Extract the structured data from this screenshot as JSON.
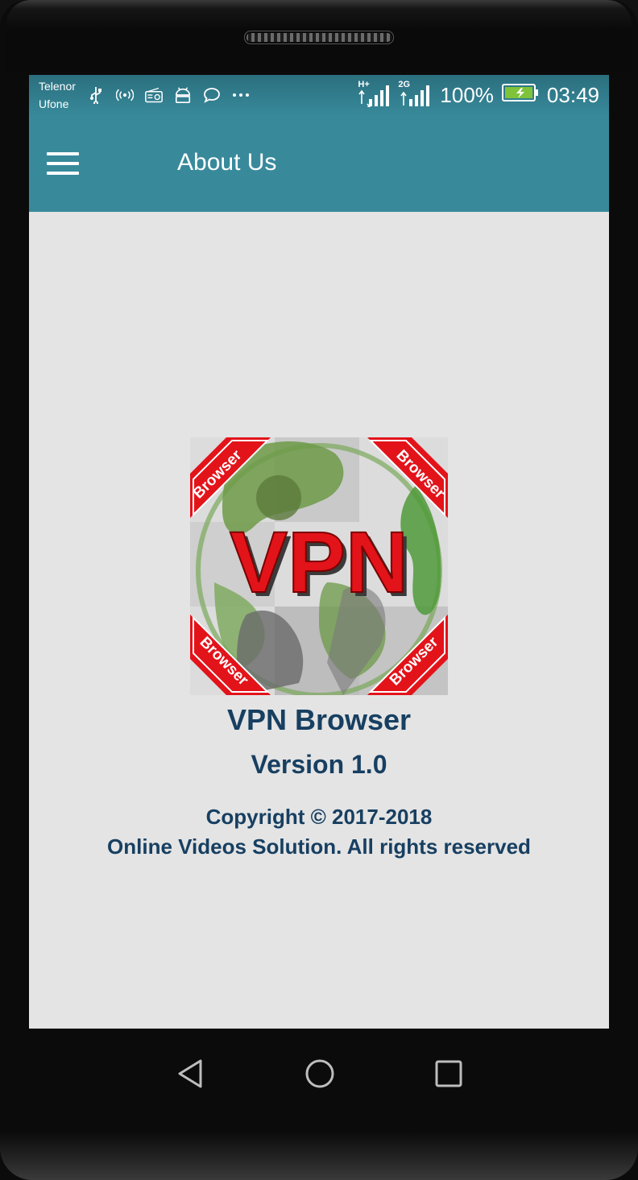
{
  "status_bar": {
    "carrier_1": "Telenor",
    "carrier_2": "Ufone",
    "network_1": "H+",
    "network_2": "2G",
    "battery": "100%",
    "time": "03:49",
    "icons": [
      "usb-icon",
      "hotspot-icon",
      "radio-icon",
      "android-icon",
      "chat-icon",
      "more-icon"
    ]
  },
  "toolbar": {
    "title": "About Us",
    "menu_icon": "hamburger-menu-icon",
    "color": "#388a9b"
  },
  "about": {
    "logo": {
      "text": "VPN",
      "ribbon_text": "Browser"
    },
    "app_name": "VPN Browser",
    "version": "Version 1.0",
    "copyright_line_1": "Copyright © 2017-2018",
    "copyright_line_2": "Online Videos Solution. All rights reserved",
    "text_color": "#173f61"
  },
  "nav_bar": {
    "icons": [
      "back-icon",
      "home-icon",
      "recents-icon"
    ]
  }
}
